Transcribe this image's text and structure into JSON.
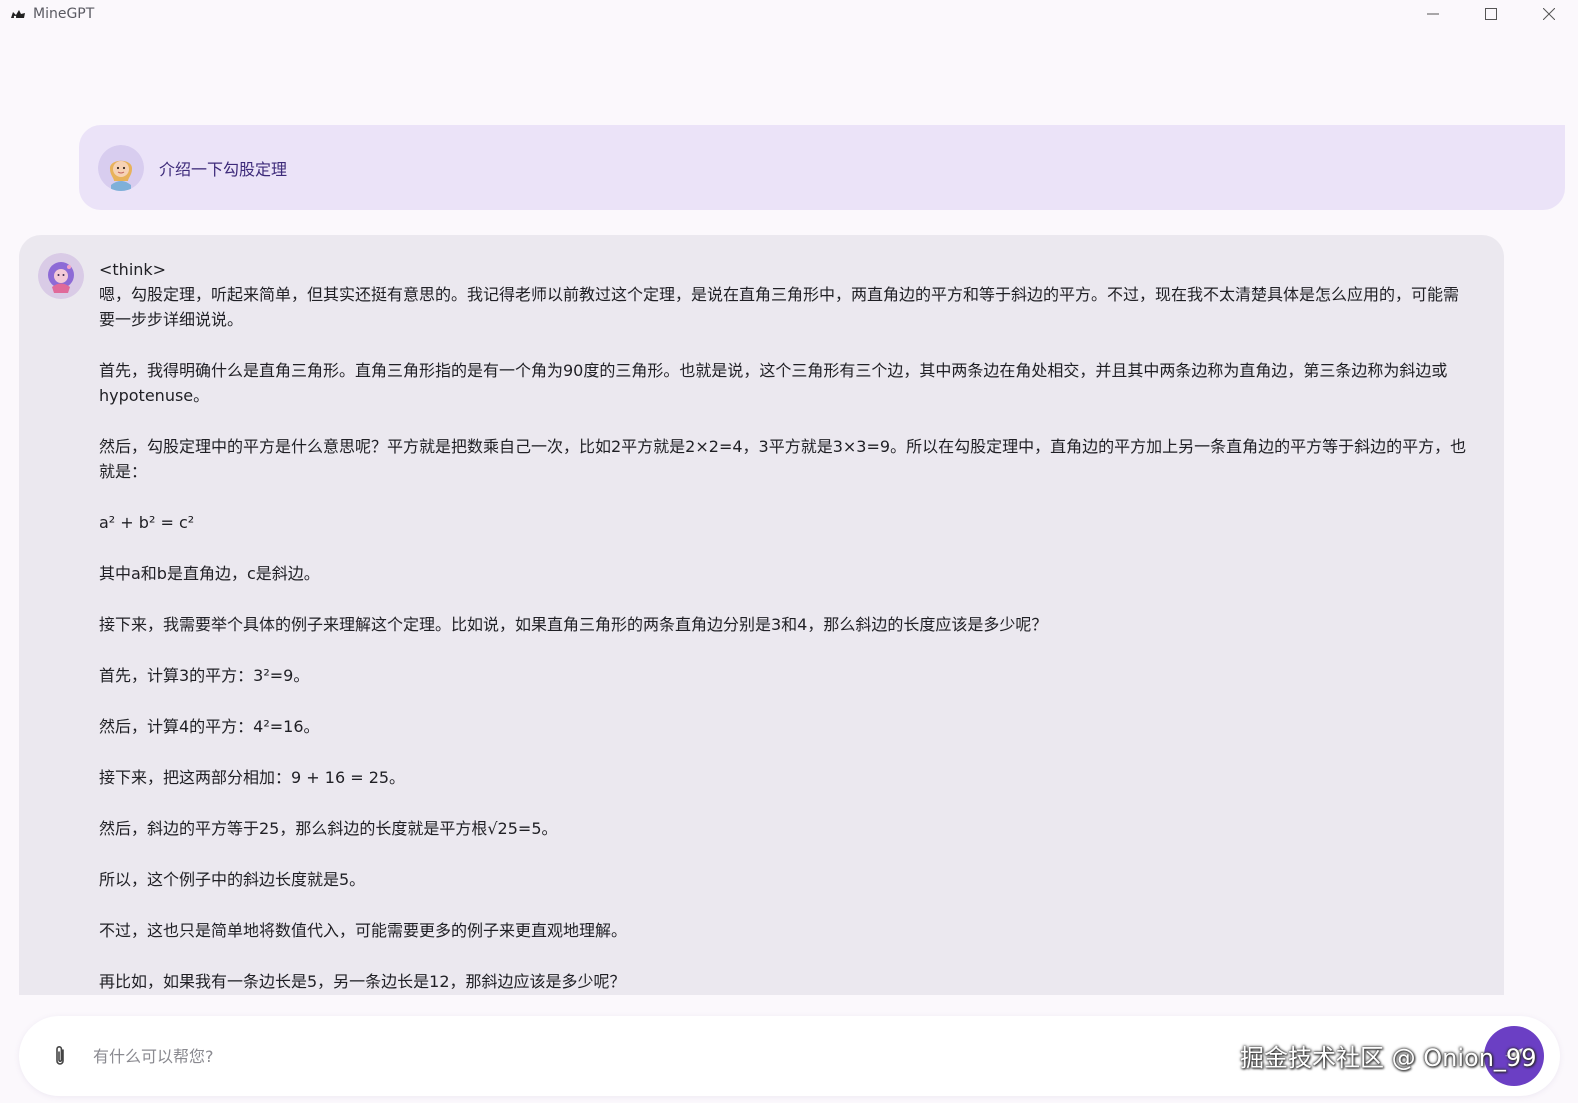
{
  "window": {
    "title": "MineGPT",
    "icons": {
      "app": "app-logo-icon",
      "minimize": "minimize-icon",
      "maximize": "maximize-icon",
      "close": "close-icon"
    }
  },
  "conversation": {
    "user_message": {
      "avatar": "user-avatar",
      "text": "介绍一下勾股定理"
    },
    "assistant_message": {
      "avatar": "assistant-avatar",
      "think_tag": "<think>",
      "paragraphs": [
        "嗯，勾股定理，听起来简单，但其实还挺有意思的。我记得老师以前教过这个定理，是说在直角三角形中，两直角边的平方和等于斜边的平方。不过，现在我不太清楚具体是怎么应用的，可能需要一步步详细说说。",
        "首先，我得明确什么是直角三角形。直角三角形指的是有一个角为90度的三角形。也就是说，这个三角形有三个边，其中两条边在角处相交，并且其中两条边称为直角边，第三条边称为斜边或hypotenuse。",
        "然后，勾股定理中的平方是什么意思呢？平方就是把数乘自己一次，比如2平方就是2×2=4，3平方就是3×3=9。所以在勾股定理中，直角边的平方加上另一条直角边的平方等于斜边的平方，也就是：",
        "a² + b² = c²",
        "其中a和b是直角边，c是斜边。",
        "接下来，我需要举个具体的例子来理解这个定理。比如说，如果直角三角形的两条直角边分别是3和4，那么斜边的长度应该是多少呢？",
        "首先，计算3的平方：3²=9。",
        "然后，计算4的平方：4²=16。",
        "接下来，把这两部分相加：9 + 16 = 25。",
        "然后，斜边的平方等于25，那么斜边的长度就是平方根√25=5。",
        "所以，这个例子中的斜边长度就是5。",
        "不过，这也只是简单地将数值代入，可能需要更多的例子来更直观地理解。",
        "再比如，如果我有一条边长是5，另一条边长是12，那斜边应该是多少呢？"
      ]
    }
  },
  "input": {
    "placeholder": "有什么可以帮您?",
    "value": "",
    "attach_icon": "paperclip-icon",
    "send_icon": "send-icon"
  },
  "watermark": "掘金技术社区 @ Onion_99",
  "colors": {
    "background": "#fbf8fc",
    "user_bubble": "#ebe3f8",
    "assistant_bubble": "#ebe8ef",
    "accent": "#6b3fc4",
    "user_text": "#3d2a7a"
  }
}
